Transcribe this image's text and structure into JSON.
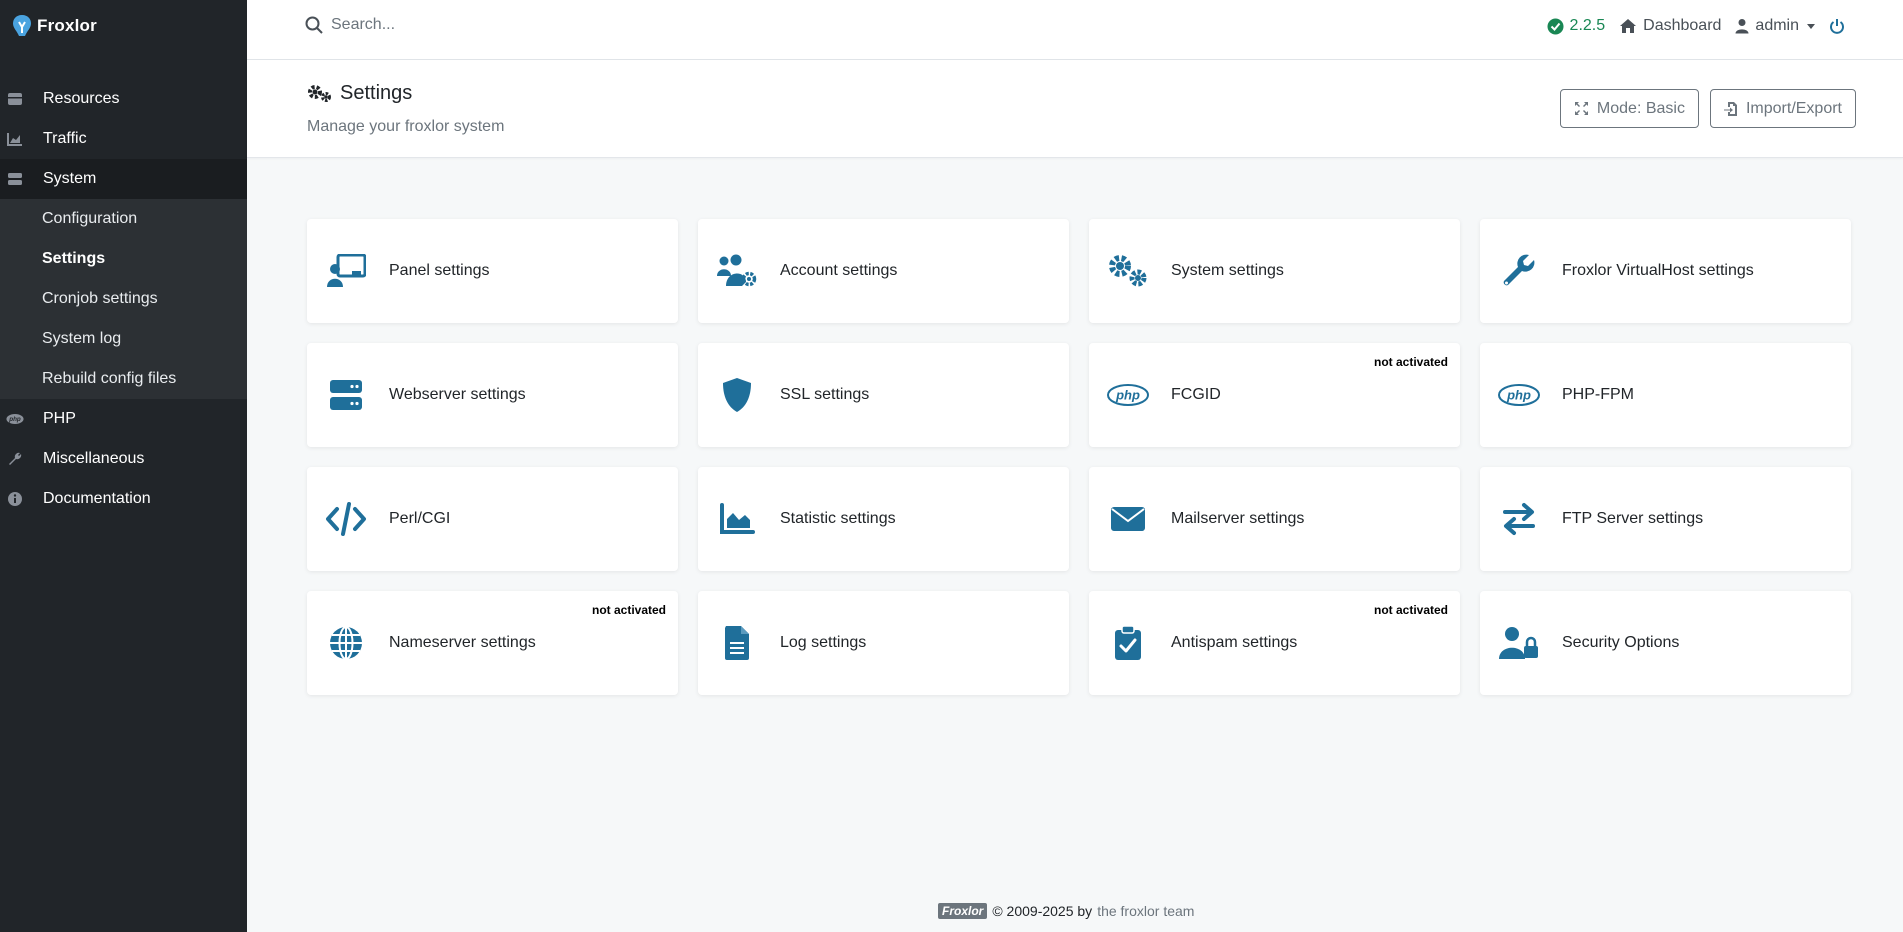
{
  "brand": {
    "name": "Froxlor"
  },
  "sidebar": {
    "items": [
      {
        "label": "Resources",
        "icon": "database-icon"
      },
      {
        "label": "Traffic",
        "icon": "area-chart-icon"
      },
      {
        "label": "System",
        "icon": "server-icon"
      }
    ],
    "system_sub": [
      {
        "label": "Configuration"
      },
      {
        "label": "Settings"
      },
      {
        "label": "Cronjob settings"
      },
      {
        "label": "System log"
      },
      {
        "label": "Rebuild config files"
      }
    ],
    "items_after": [
      {
        "label": "PHP",
        "icon": "php-icon"
      },
      {
        "label": "Miscellaneous",
        "icon": "wrench-icon"
      },
      {
        "label": "Documentation",
        "icon": "info-circle-icon"
      }
    ]
  },
  "topbar": {
    "search_placeholder": "Search...",
    "version": "2.2.5",
    "dashboard": "Dashboard",
    "user": "admin"
  },
  "header": {
    "title": "Settings",
    "subtitle": "Manage your froxlor system",
    "mode_button": "Mode: Basic",
    "import_export_button": "Import/Export"
  },
  "cards": [
    {
      "label": "Panel settings",
      "icon": "chalkboard-user-icon",
      "badge": ""
    },
    {
      "label": "Account settings",
      "icon": "users-cog-icon",
      "badge": ""
    },
    {
      "label": "System settings",
      "icon": "gears-icon",
      "badge": ""
    },
    {
      "label": "Froxlor VirtualHost settings",
      "icon": "wrench-icon",
      "badge": ""
    },
    {
      "label": "Webserver settings",
      "icon": "server-icon",
      "badge": ""
    },
    {
      "label": "SSL settings",
      "icon": "shield-icon",
      "badge": ""
    },
    {
      "label": "FCGID",
      "icon": "php-icon",
      "badge": "not activated"
    },
    {
      "label": "PHP-FPM",
      "icon": "php-icon",
      "badge": ""
    },
    {
      "label": "Perl/CGI",
      "icon": "code-icon",
      "badge": ""
    },
    {
      "label": "Statistic settings",
      "icon": "area-chart-icon",
      "badge": ""
    },
    {
      "label": "Mailserver settings",
      "icon": "envelope-icon",
      "badge": ""
    },
    {
      "label": "FTP Server settings",
      "icon": "arrows-exchange-icon",
      "badge": ""
    },
    {
      "label": "Nameserver settings",
      "icon": "globe-icon",
      "badge": "not activated"
    },
    {
      "label": "Log settings",
      "icon": "file-lines-icon",
      "badge": ""
    },
    {
      "label": "Antispam settings",
      "icon": "clipboard-check-icon",
      "badge": "not activated"
    },
    {
      "label": "Security Options",
      "icon": "user-lock-icon",
      "badge": ""
    }
  ],
  "footer": {
    "logo": "Froxlor",
    "copyright": "© 2009-2025 by",
    "team": "the froxlor team"
  },
  "colors": {
    "sidebar_bg": "#212529",
    "accent": "#1f6f9a",
    "version_green": "#198754"
  }
}
